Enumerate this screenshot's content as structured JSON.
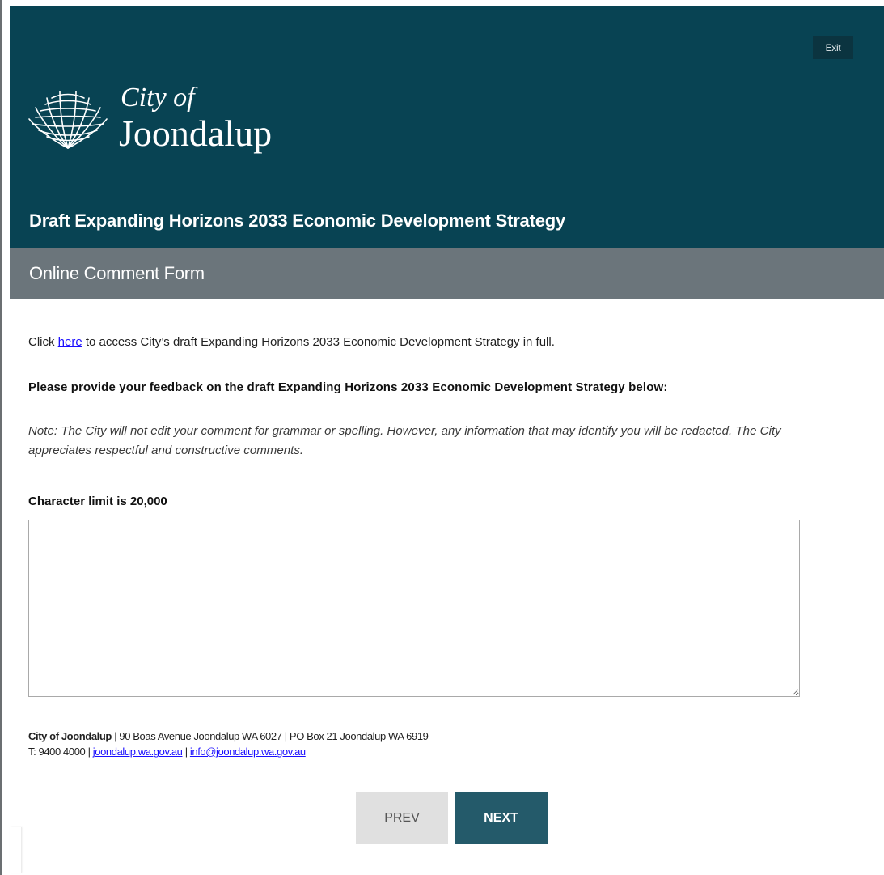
{
  "header": {
    "exit_label": "Exit",
    "logo_line1": "City of",
    "logo_line2": "Joondalup",
    "page_title": "Draft Expanding Horizons 2033 Economic Development Strategy"
  },
  "subheader": {
    "title": "Online Comment Form"
  },
  "content": {
    "intro_prefix": "Click ",
    "intro_link": "here",
    "intro_suffix": " to access City’s draft Expanding Horizons 2033 Economic Development Strategy in full.",
    "question": "Please provide your feedback on the draft Expanding Horizons 2033 Economic Development Strategy below:",
    "note": "Note: The City will not edit your comment for grammar or spelling. However, any information that may identify you will be redacted. The City appreciates respectful and constructive comments.",
    "char_limit_label": "Character limit is 20,000",
    "comment_value": ""
  },
  "footer": {
    "org_name": "City of Joondalup",
    "address": " | 90 Boas Avenue Joondalup WA 6027 | PO Box 21 Joondalup WA 6919",
    "phone": "T: 9400 4000 | ",
    "website": "joondalup.wa.gov.au",
    "separator": " | ",
    "email": "info@joondalup.wa.gov.au"
  },
  "nav": {
    "prev_label": "PREV",
    "next_label": "NEXT"
  },
  "colors": {
    "header_bg": "#084353",
    "subheader_bg": "#6b757b",
    "next_button_bg": "#245a6a",
    "prev_button_bg": "#e0e0e0",
    "link": "#1a0dff"
  },
  "icons": {
    "logo": "joondalup-leaf-logo"
  }
}
